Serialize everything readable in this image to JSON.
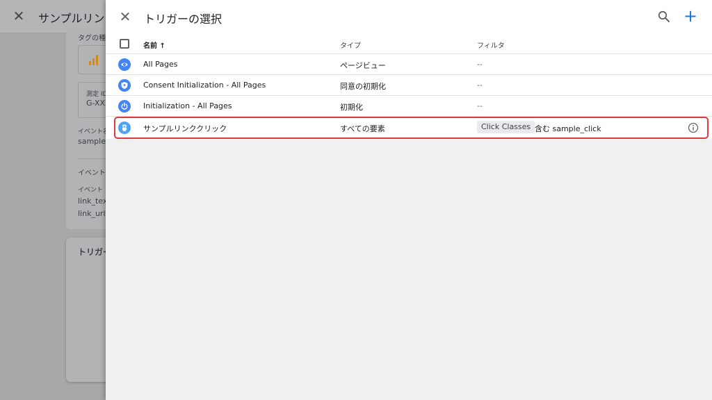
{
  "background": {
    "title": "サンプルリンク",
    "labels": {
      "tag_type": "タグの種類",
      "measurement_id_label": "測定 ID",
      "measurement_id_value": "G-XXX",
      "event_name_label": "イベント名",
      "event_name_value": "sample_",
      "event_params_label": "イベント",
      "param_header": "イベント",
      "param1": "link_text",
      "param2": "link_url",
      "trigger_title": "トリガー"
    }
  },
  "panel": {
    "title": "トリガーの選択",
    "columns": {
      "name": "名前 ↑",
      "type": "タイプ",
      "filter": "フィルタ"
    },
    "rows": [
      {
        "name": "All Pages",
        "type": "ページビュー",
        "filter": "--",
        "icon": "eye-icon",
        "icon_color": "#4285f4"
      },
      {
        "name": "Consent Initialization - All Pages",
        "type": "同意の初期化",
        "filter": "--",
        "icon": "shield-icon",
        "icon_color": "#4285f4"
      },
      {
        "name": "Initialization - All Pages",
        "type": "初期化",
        "filter": "--",
        "icon": "power-icon",
        "icon_color": "#4285f4"
      },
      {
        "name": "サンプルリンククリック",
        "type": "すべての要素",
        "filter_chip": "Click Classes",
        "filter_condition": "含む sample_click",
        "icon": "mouse-icon",
        "icon_color": "#4fa3f5"
      }
    ]
  },
  "colors": {
    "accent": "#1a73e8",
    "highlight_border": "#e0383e"
  }
}
